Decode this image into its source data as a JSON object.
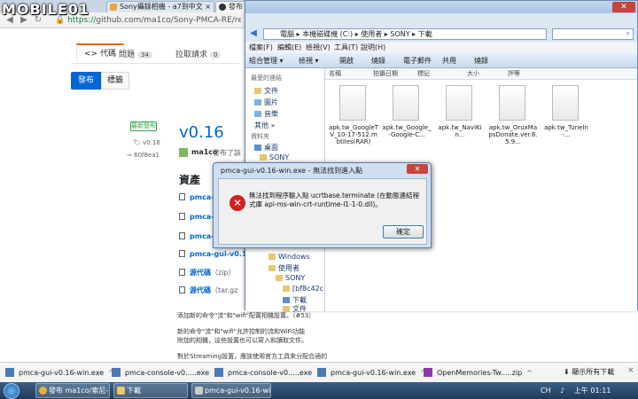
{
  "browser": {
    "logo_text": "MOBILE01",
    "tabs": [
      {
        "label": "Sony攝錄相機 - a7到中文 ×",
        "active": false
      },
      {
        "label": "發布 ma1co/索尼-PMCA-R ×",
        "active": true
      }
    ],
    "url_https": "https://",
    "url_rest": "github.com/ma1co/Sony-PMCA-RE/rele"
  },
  "github": {
    "tabs": [
      {
        "label": "<> 代碼",
        "count": ""
      },
      {
        "label": "問題",
        "count": "34"
      },
      {
        "label": "拉取請求",
        "count": "0"
      }
    ],
    "releases_label": "發布",
    "tags_label": "標籤",
    "latest_badge": "最新發布",
    "tag": "v0.16",
    "commit": "60f8ea1",
    "version_title": "v0.16",
    "author": "ma1co",
    "author_rest": "發布了該",
    "assets_heading": "資產",
    "assets": [
      "pmca-",
      "pmca-",
      "pmca-",
      "pmca-gui-v0.1"
    ],
    "sources": [
      {
        "label": "源代碼",
        "fmt": "（zip）"
      },
      {
        "label": "源代碼",
        "fmt": "（tar.gz"
      }
    ],
    "notes": [
      "添加新的命令\"流\"和\"wifi\"配置相機設置。（#53）",
      "新的命令\"流\"和\"wifi\"允許控制的流和WiFi功能",
      "附加的相機，這些設置也可以寫入和讀取文件。",
      "對於Streaming設置，應該使用官方工具來分配合適的"
    ]
  },
  "explorer": {
    "breadcrumb": "電腦 ▸ 本機磁碟機 (C:) ▸ 使用者 ▸ SONY ▸ 下載",
    "menu": [
      "檔案(F)",
      "編輯(E)",
      "檢視(V)",
      "工具(T)",
      "說明(H)"
    ],
    "commands": [
      "組合管理 ▾",
      "檢視 ▾",
      "開啟",
      "燒錄",
      "電子郵件",
      "共用",
      "燒錄"
    ],
    "nav_head_fav": "最愛的連結",
    "nav_fav": [
      "文件",
      "圖片",
      "音樂",
      "其他 »"
    ],
    "nav_head_folders": "資料夾",
    "nav_folders": [
      "桌面",
      "SONY",
      "Windows",
      "使用者",
      "SONY",
      "[bf8c42c",
      "下載",
      "文件"
    ],
    "columns": [
      "名稱",
      "拍攝日期",
      "標記",
      "大小",
      "評等"
    ],
    "files": [
      "apk.tw_GoogleTV_10-17-512.mbtiles(RAR)",
      "apk.tw_Google_-Google-C...",
      "apk.tw_NaviKin...",
      "apk.tw_OruxMapsDonate.ver.6.5.9...",
      "apk.tw_TuneIn-..."
    ]
  },
  "dialog": {
    "title": "pmca-gui-v0.16-win.exe - 無法找到進入點",
    "message": "無法找到程序輸入點 ucrtbase.terminate (在動態連結程式庫 api-ms-win-crt-runtime-l1-1-0.dll)。",
    "ok_label": "確定"
  },
  "downloads": {
    "items": [
      "pmca-gui-v0.16-win.exe",
      "pmca-console-v0.....exe",
      "pmca-console-v0.....exe",
      "pmca-gui-v0.16-win.exe",
      "OpenMemories-Tw.....zip"
    ],
    "show_all": "顯示所有下載",
    "close": "×"
  },
  "taskbar": {
    "items": [
      "發布 ma1co/索尼-...",
      "下載",
      "pmca-gui-v0.16-wi..."
    ],
    "clock": "上午 01:11",
    "lang": "CH"
  },
  "colors": {
    "accent": "#0366d6",
    "error": "#d11f1f"
  }
}
